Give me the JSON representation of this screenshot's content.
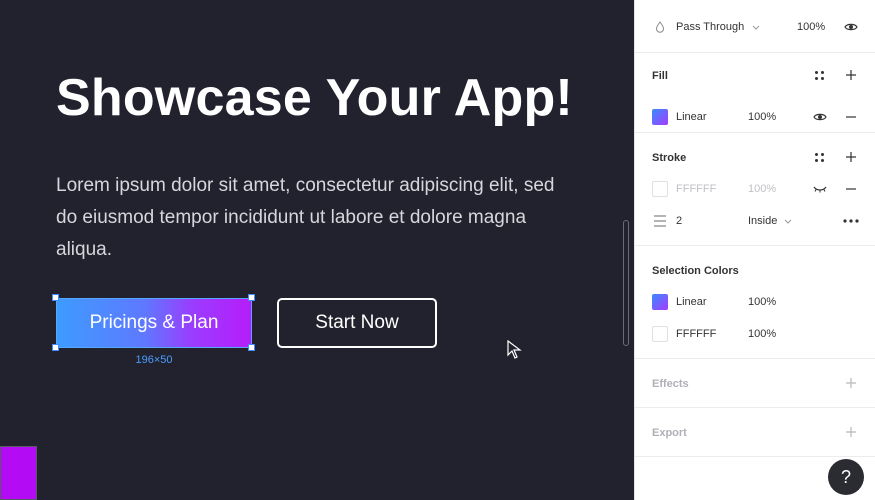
{
  "canvas": {
    "title": "Showcase Your App!",
    "body": "Lorem ipsum dolor sit amet, consectetur adipiscing elit, sed do eiusmod tempor incididunt ut labore et dolore magna aliqua.",
    "primary_button": "Pricings & Plan",
    "secondary_button": "Start Now",
    "selection_size": "196×50"
  },
  "panel": {
    "layer": {
      "blend_mode": "Pass Through",
      "opacity": "100%"
    },
    "fill": {
      "title": "Fill",
      "type": "Linear",
      "opacity": "100%"
    },
    "stroke": {
      "title": "Stroke",
      "color": "FFFFFF",
      "opacity": "100%",
      "weight": "2",
      "position": "Inside"
    },
    "selection_colors": {
      "title": "Selection Colors",
      "items": [
        {
          "label": "Linear",
          "opacity": "100%"
        },
        {
          "label": "FFFFFF",
          "opacity": "100%"
        }
      ]
    },
    "effects": {
      "title": "Effects"
    },
    "export": {
      "title": "Export"
    },
    "help": "?"
  },
  "colors": {
    "canvas_bg": "#22222e",
    "accent_blue": "#3e9bff",
    "accent_purple": "#b51dfa",
    "selection": "#4a9cff"
  }
}
